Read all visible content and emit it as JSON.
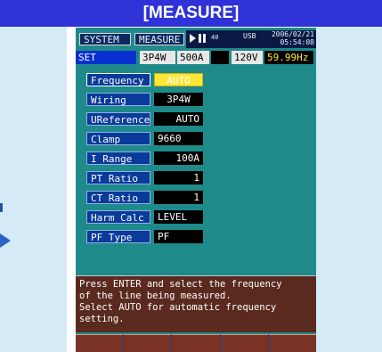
{
  "banner": {
    "title": "[MEASURE]"
  },
  "topbar": {
    "tabs": [
      {
        "label": "SYSTEM"
      },
      {
        "label": "MEASURE"
      }
    ],
    "status": {
      "pause": "40",
      "usb": "USB",
      "date": "2006/02/21",
      "time": "05:54:08"
    }
  },
  "setbar": {
    "mode": "SET",
    "wiring": "3P4W",
    "current": "500A",
    "voltage": "120V",
    "frequency": "59.99Hz"
  },
  "settings": [
    {
      "label": "Frequency",
      "value": "AUTO"
    },
    {
      "label": "Wiring",
      "value": "3P4W"
    },
    {
      "label": "UReference",
      "value": "AUTO"
    },
    {
      "label": "Clamp",
      "value": "9660"
    },
    {
      "label": "I Range",
      "value": "100A"
    },
    {
      "label": "PT Ratio",
      "value": "1"
    },
    {
      "label": "CT Ratio",
      "value": "1"
    },
    {
      "label": "Harm Calc",
      "value": "LEVEL"
    },
    {
      "label": "PF Type",
      "value": "PF"
    }
  ],
  "help": {
    "lines": [
      "Press ENTER and select the frequency",
      "of the line being measured.",
      "Select AUTO for automatic frequency",
      "setting."
    ]
  },
  "colors": {
    "screen_bg": "#1f8a8a",
    "banner": "#2f32d6",
    "highlight": "#ffe63a",
    "help_bg": "#5a2a1f"
  }
}
